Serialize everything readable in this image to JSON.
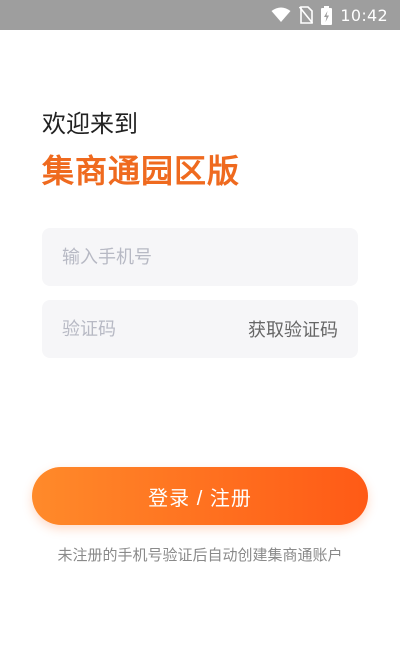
{
  "status_bar": {
    "time": "10:42",
    "icons": [
      "wifi-icon",
      "no-sim-icon",
      "battery-charging-icon"
    ]
  },
  "header": {
    "welcome": "欢迎来到",
    "brand": "集商通园区版"
  },
  "form": {
    "phone_placeholder": "输入手机号",
    "phone_value": "",
    "code_placeholder": "验证码",
    "code_value": "",
    "get_code_label": "获取验证码"
  },
  "actions": {
    "login_label": "登录 / 注册"
  },
  "footer": {
    "notice": "未注册的手机号验证后自动创建集商通账户"
  },
  "colors": {
    "brand": "#ef6a1f",
    "button_start": "#ff8a2a",
    "button_end": "#ff5a16",
    "status_bar": "#9e9e9e",
    "field_bg": "#f6f6f8"
  }
}
